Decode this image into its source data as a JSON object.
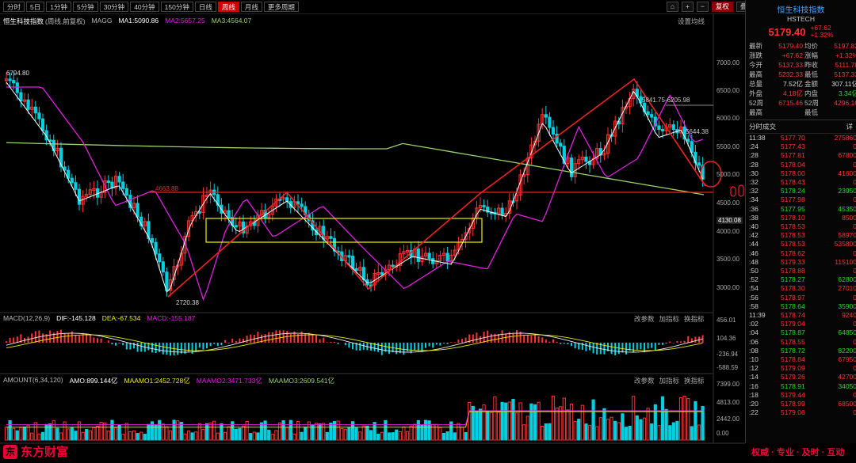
{
  "tabs": [
    "分时",
    "5日",
    "1分钟",
    "5分钟",
    "30分钟",
    "40分钟",
    "150分钟",
    "日线",
    "周线",
    "月线",
    "更多周期"
  ],
  "active_tab": 8,
  "toolbar": {
    "fq": "复权",
    "add": "叠加",
    "week": "周线",
    "display": "显示",
    "tools": "经筹",
    "hide": "隐藏"
  },
  "title_label": "恒生科技指数",
  "ma_legend": {
    "name": "恒生科技指数",
    "fq": "(周线,前复权)",
    "magg": "MAGG",
    "ma1": "MA1:5090.86",
    "ma2": "MA2:5657.25",
    "ma3": "MA3:4564.07"
  },
  "settings": "设置均线",
  "y_axis": [
    "7000.00",
    "6500.00",
    "6000.00",
    "5500.00",
    "5000.00",
    "4500.00",
    "4000.00",
    "3500.00",
    "3000.00"
  ],
  "price_marks": {
    "high": "6794.80",
    "low": "2720.38",
    "support": "4663.88",
    "r1": "5841.75-6205.98",
    "r2": "5644.38",
    "current": "4130.08"
  },
  "macd": {
    "name": "MACD(12,26,9)",
    "dif": "DIF:-145.128",
    "dea": "DEA:-67.534",
    "macd": "MACD:-155.187",
    "axis": [
      "456.01",
      "104.36",
      "-236.94",
      "-588.59"
    ]
  },
  "amount": {
    "name": "AMOUNT(6,34,120)",
    "amo": "AMO:899.144亿",
    "m1": "MAAMO1:2452.728亿",
    "m2": "MAAMO2:3471.733亿",
    "m3": "MAAMO3:2609.541亿",
    "axis": [
      "7399.00",
      "4813.00",
      "2442.00",
      "0.00"
    ]
  },
  "ind_tools": [
    "改参数",
    "加指标",
    "换指标"
  ],
  "right_panel": {
    "title": "恒生科技指数",
    "code": "HSTECH",
    "price": "5179.40",
    "chg": "+67.62",
    "pct": "+1.32%",
    "quotes": [
      [
        "最新",
        "5179.40",
        "均价",
        "5197.82"
      ],
      [
        "涨跌",
        "+67.62",
        "涨幅",
        "+1.32%"
      ],
      [
        "今开",
        "5137.33",
        "昨收",
        "5111.78"
      ],
      [
        "最高",
        "5232.33",
        "最低",
        "5137.33"
      ],
      [
        "总量",
        "7.52亿",
        "金额",
        "307.11亿"
      ],
      [
        "外盘",
        "4.18亿",
        "内盘",
        "3.34亿"
      ],
      [
        "52周最高",
        "6715.46",
        "52周最低",
        "4296.16"
      ]
    ],
    "ticks_title": "分时成交",
    "ticks_btn": "详",
    "ticks": [
      {
        "t": "11:38",
        "p": "5177.70",
        "v": "275860",
        "c": "red"
      },
      {
        "t": ":24",
        "p": "5177.43",
        "v": "0",
        "c": "red"
      },
      {
        "t": ":28",
        "p": "5177.81",
        "v": "67800",
        "c": "red"
      },
      {
        "t": ":28",
        "p": "5178.04",
        "v": "0",
        "c": "red"
      },
      {
        "t": ":30",
        "p": "5178.00",
        "v": "41600",
        "c": "red"
      },
      {
        "t": ":32",
        "p": "5178.43",
        "v": "0",
        "c": "red"
      },
      {
        "t": ":32",
        "p": "5178.24",
        "v": "23950",
        "c": "grn"
      },
      {
        "t": ":34",
        "p": "5177.98",
        "v": "0",
        "c": "red"
      },
      {
        "t": ":36",
        "p": "5177.95",
        "v": "45350",
        "c": "grn"
      },
      {
        "t": ":38",
        "p": "5178.10",
        "v": "8500",
        "c": "red"
      },
      {
        "t": ":40",
        "p": "5178.53",
        "v": "0",
        "c": "red"
      },
      {
        "t": ":42",
        "p": "5178.53",
        "v": "58970",
        "c": "red"
      },
      {
        "t": ":44",
        "p": "5178.53",
        "v": "535800",
        "c": "red"
      },
      {
        "t": ":46",
        "p": "5178.62",
        "v": "0",
        "c": "red"
      },
      {
        "t": ":48",
        "p": "5179.33",
        "v": "115100",
        "c": "red"
      },
      {
        "t": ":50",
        "p": "5178.88",
        "v": "0",
        "c": "red"
      },
      {
        "t": ":52",
        "p": "5178.27",
        "v": "62800",
        "c": "grn"
      },
      {
        "t": ":54",
        "p": "5178.30",
        "v": "27010",
        "c": "red"
      },
      {
        "t": ":56",
        "p": "5178.97",
        "v": "0",
        "c": "red"
      },
      {
        "t": ":58",
        "p": "5178.64",
        "v": "35900",
        "c": "grn"
      },
      {
        "t": "11:39",
        "p": "5178.74",
        "v": "9240",
        "c": "red"
      },
      {
        "t": ":02",
        "p": "5179.04",
        "v": "0",
        "c": "red"
      },
      {
        "t": ":04",
        "p": "5178.87",
        "v": "64850",
        "c": "grn"
      },
      {
        "t": ":06",
        "p": "5178.55",
        "v": "0",
        "c": "red"
      },
      {
        "t": ":08",
        "p": "5178.72",
        "v": "82200",
        "c": "grn"
      },
      {
        "t": ":10",
        "p": "5178.84",
        "v": "67950",
        "c": "red"
      },
      {
        "t": ":12",
        "p": "5179.09",
        "v": "0",
        "c": "red"
      },
      {
        "t": ":14",
        "p": "5179.26",
        "v": "42700",
        "c": "red"
      },
      {
        "t": ":16",
        "p": "5178.91",
        "v": "34050",
        "c": "grn"
      },
      {
        "t": ":18",
        "p": "5179.44",
        "v": "0",
        "c": "red"
      },
      {
        "t": ":20",
        "p": "5178.99",
        "v": "68500",
        "c": "red"
      },
      {
        "t": ":22",
        "p": "5179.06",
        "v": "0",
        "c": "red"
      }
    ]
  },
  "logo": "东方财富",
  "logo_mark": "东",
  "slogan": "权威 · 专业 · 及时 · 互动",
  "colors": {
    "up": "#ff3333",
    "down": "#00d0e0",
    "accent": "#cc0000"
  }
}
